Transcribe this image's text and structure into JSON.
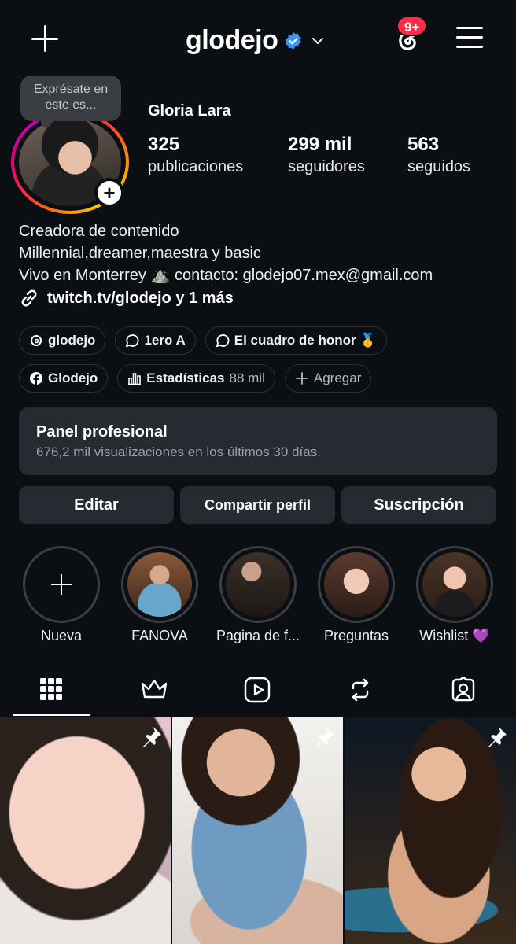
{
  "header": {
    "username": "glodejo",
    "notification_badge": "9+",
    "icons": {
      "create": "plus-icon",
      "threads": "threads-icon",
      "menu": "hamburger-menu-icon",
      "verified": "verified-badge-icon",
      "dropdown": "chevron-down-icon"
    }
  },
  "profile": {
    "note": "Exprésate en este es...",
    "full_name": "Gloria Lara",
    "stats": [
      {
        "value": "325",
        "label": "publicaciones"
      },
      {
        "value": "299 mil",
        "label": "seguidores"
      },
      {
        "value": "563",
        "label": "seguidos"
      }
    ],
    "bio_lines": [
      "Creadora de contenido",
      "Millennial,dreamer,maestra y basic",
      "Vivo en Monterrey ⛰️  contacto: glodejo07.mex@gmail.com"
    ],
    "link": "twitch.tv/glodejo y 1 más"
  },
  "chips_row1": [
    {
      "label": "glodejo",
      "icon": "threads-icon"
    },
    {
      "label": "1ero A",
      "icon": "chat-bubble-icon"
    },
    {
      "label": "El cuadro de honor 🥇",
      "icon": "chat-bubble-icon"
    }
  ],
  "chips_row2": [
    {
      "label": "Glodejo",
      "icon": "facebook-icon"
    },
    {
      "label": "Estadísticas",
      "extra": "88 mil",
      "icon": "bar-chart-icon"
    },
    {
      "label": "Agregar",
      "icon": "plus-icon"
    }
  ],
  "panel": {
    "title": "Panel profesional",
    "subtitle": "676,2 mil visualizaciones en los últimos 30 días."
  },
  "actions": {
    "edit": "Editar",
    "share": "Compartir perfil",
    "subscribe": "Suscripción"
  },
  "highlights": [
    {
      "label": "Nueva"
    },
    {
      "label": "FANOVA"
    },
    {
      "label": "Pagina de f..."
    },
    {
      "label": "Preguntas"
    },
    {
      "label": "Wishlist 💜"
    }
  ],
  "tabs": [
    "grid-icon",
    "crown-icon",
    "reels-icon",
    "reposts-icon",
    "tagged-icon"
  ],
  "colors": {
    "background": "#0b0f14",
    "surface": "#262a31",
    "badge": "#ff2b4a",
    "verified": "#3897f0"
  }
}
